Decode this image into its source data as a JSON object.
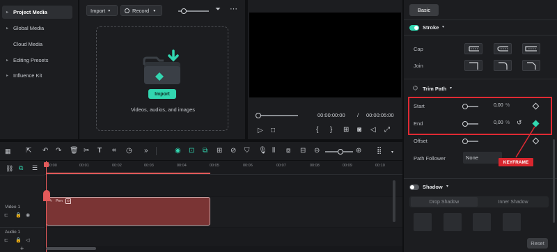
{
  "sidebar": {
    "items": [
      {
        "label": "Project Media",
        "active": true,
        "has_arrow": true
      },
      {
        "label": "Global Media",
        "active": false,
        "has_arrow": true
      },
      {
        "label": "Cloud Media",
        "active": false,
        "has_arrow": false
      },
      {
        "label": "Editing Presets",
        "active": false,
        "has_arrow": true
      },
      {
        "label": "Influence Kit",
        "active": false,
        "has_arrow": true
      }
    ]
  },
  "media": {
    "import_dropdown": "Import",
    "record_dropdown": "Record",
    "import_button": "Import",
    "drop_hint": "Videos, audios, and images"
  },
  "preview": {
    "current_time": "00:00:00:00",
    "separator": "/",
    "total_time": "00:00:05:00"
  },
  "props": {
    "tab_basic": "Basic",
    "stroke": {
      "title": "Stroke",
      "enabled": true,
      "cap_label": "Cap",
      "join_label": "Join"
    },
    "trim_path": {
      "title": "Trim Path",
      "rows": [
        {
          "label": "Start",
          "value": "0,00",
          "unit": "%"
        },
        {
          "label": "End",
          "value": "0,00",
          "unit": "%"
        },
        {
          "label": "Offset",
          "value": "",
          "unit": ""
        }
      ]
    },
    "path_follow_label": "Path Follower",
    "path_follow_value": "None",
    "keyframe_annotation": "KEYFRAME",
    "shadow": {
      "title": "Shadow",
      "enabled": false,
      "tab_drop": "Drop Shadow",
      "tab_inner": "Inner Shadow"
    },
    "reset_button": "Reset"
  },
  "timeline": {
    "ruler": [
      "00:00",
      "00:01",
      "00:02",
      "00:03",
      "00:04",
      "00:05",
      "00:06",
      "00:07",
      "00:08",
      "00:09",
      "00:10"
    ],
    "video_track_label": "Video 1",
    "audio_track_label": "Audio 1",
    "clip_title": "Pen"
  },
  "colors": {
    "accent": "#32d6b0",
    "annotation_red": "#e02a33",
    "clip_fill": "#7a3434"
  }
}
